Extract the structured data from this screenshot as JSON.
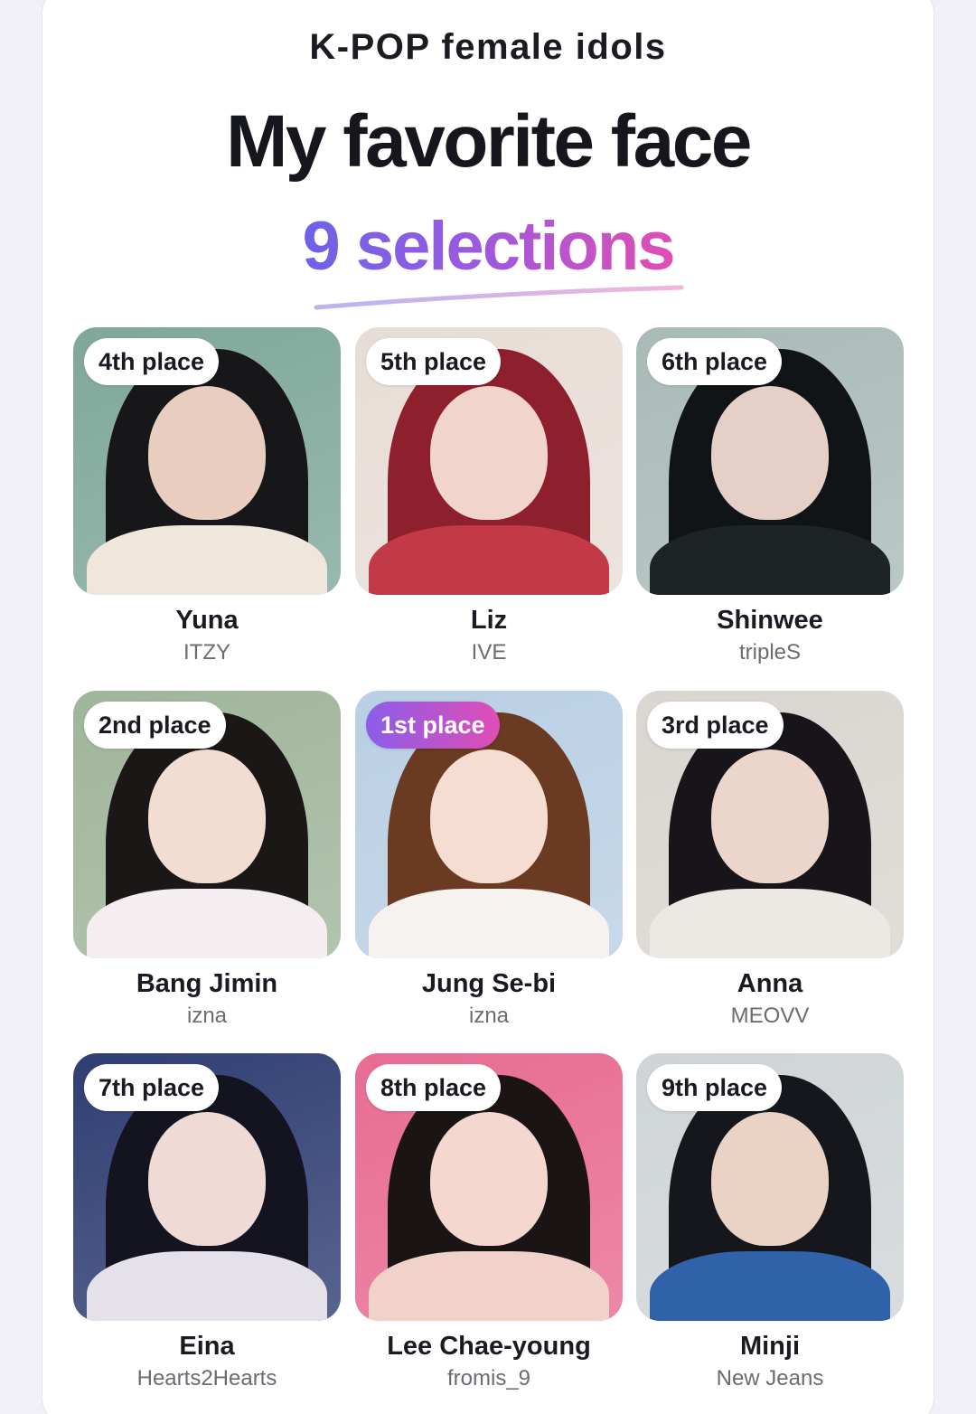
{
  "header": {
    "subtitle": "K-POP female idols",
    "title": "My favorite face",
    "count_label": "9 selections"
  },
  "colors": {
    "accent_start": "#6b63e8",
    "accent_end": "#e14db4",
    "text_primary": "#1a1a22",
    "text_secondary": "#6b6b72"
  },
  "idols": [
    {
      "place": "4th place",
      "name": "Yuna",
      "group": "ITZY",
      "bg": "#7fa79a",
      "hair": "#17171a",
      "skin": "#e9cdbf",
      "cloth": "#efe7dc",
      "first": false
    },
    {
      "place": "5th place",
      "name": "Liz",
      "group": "IVE",
      "bg": "#e8dcd6",
      "hair": "#8e1f2c",
      "skin": "#f1d4cb",
      "cloth": "#c23a48",
      "first": false
    },
    {
      "place": "6th place",
      "name": "Shinwee",
      "group": "tripleS",
      "bg": "#a9bab7",
      "hair": "#101417",
      "skin": "#e6cfc6",
      "cloth": "#1d2426",
      "first": false
    },
    {
      "place": "2nd place",
      "name": "Bang Jimin",
      "group": "izna",
      "bg": "#9fb59a",
      "hair": "#1b1716",
      "skin": "#f1ddd2",
      "cloth": "#f4eef0",
      "first": false
    },
    {
      "place": "1st place",
      "name": "Jung Se-bi",
      "group": "izna",
      "bg": "#b9cfe4",
      "hair": "#6a3a22",
      "skin": "#f6ddd2",
      "cloth": "#f5f2ef",
      "first": true
    },
    {
      "place": "3rd place",
      "name": "Anna",
      "group": "MEOVV",
      "bg": "#d9d5d0",
      "hair": "#17151a",
      "skin": "#ecd6cc",
      "cloth": "#ece9e5",
      "first": false
    },
    {
      "place": "7th place",
      "name": "Eina",
      "group": "Hearts2Hearts",
      "bg": "#2f3e73",
      "hair": "#141420",
      "skin": "#f0dad6",
      "cloth": "#e5e1ea",
      "first": false
    },
    {
      "place": "8th place",
      "name": "Lee Chae-young",
      "group": "fromis_9",
      "bg": "#e86b92",
      "hair": "#1a1414",
      "skin": "#f4d8cf",
      "cloth": "#f0d2ca",
      "first": false
    },
    {
      "place": "9th place",
      "name": "Minji",
      "group": "New Jeans",
      "bg": "#cfd4d6",
      "hair": "#16171c",
      "skin": "#ead2c4",
      "cloth": "#2f62a8",
      "first": false
    }
  ]
}
